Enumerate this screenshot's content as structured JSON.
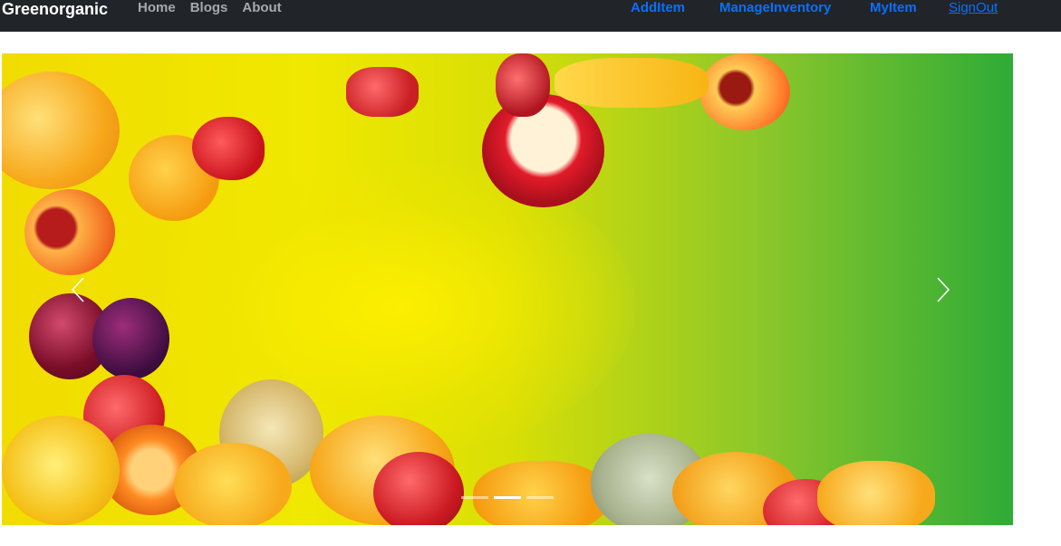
{
  "navbar": {
    "brand": "Greenorganic",
    "left_links": [
      {
        "label": "Home"
      },
      {
        "label": "Blogs"
      },
      {
        "label": "About"
      }
    ],
    "right_links": [
      {
        "label": "AddItem"
      },
      {
        "label": "ManageInventory"
      },
      {
        "label": "MyItem"
      }
    ],
    "signout": "SignOut"
  },
  "carousel": {
    "image_subject": "fruit-splash-banner",
    "slide_count": 3,
    "active_slide": 2,
    "prev_icon": "chevron-left-icon",
    "next_icon": "chevron-right-icon"
  },
  "colors": {
    "navbar_bg": "#212529",
    "brand": "#ffffff",
    "nav_link": "#a6a8ab",
    "accent_link": "#0d6efd",
    "banner_yellow": "#f0e800",
    "banner_green": "#2fab37"
  }
}
